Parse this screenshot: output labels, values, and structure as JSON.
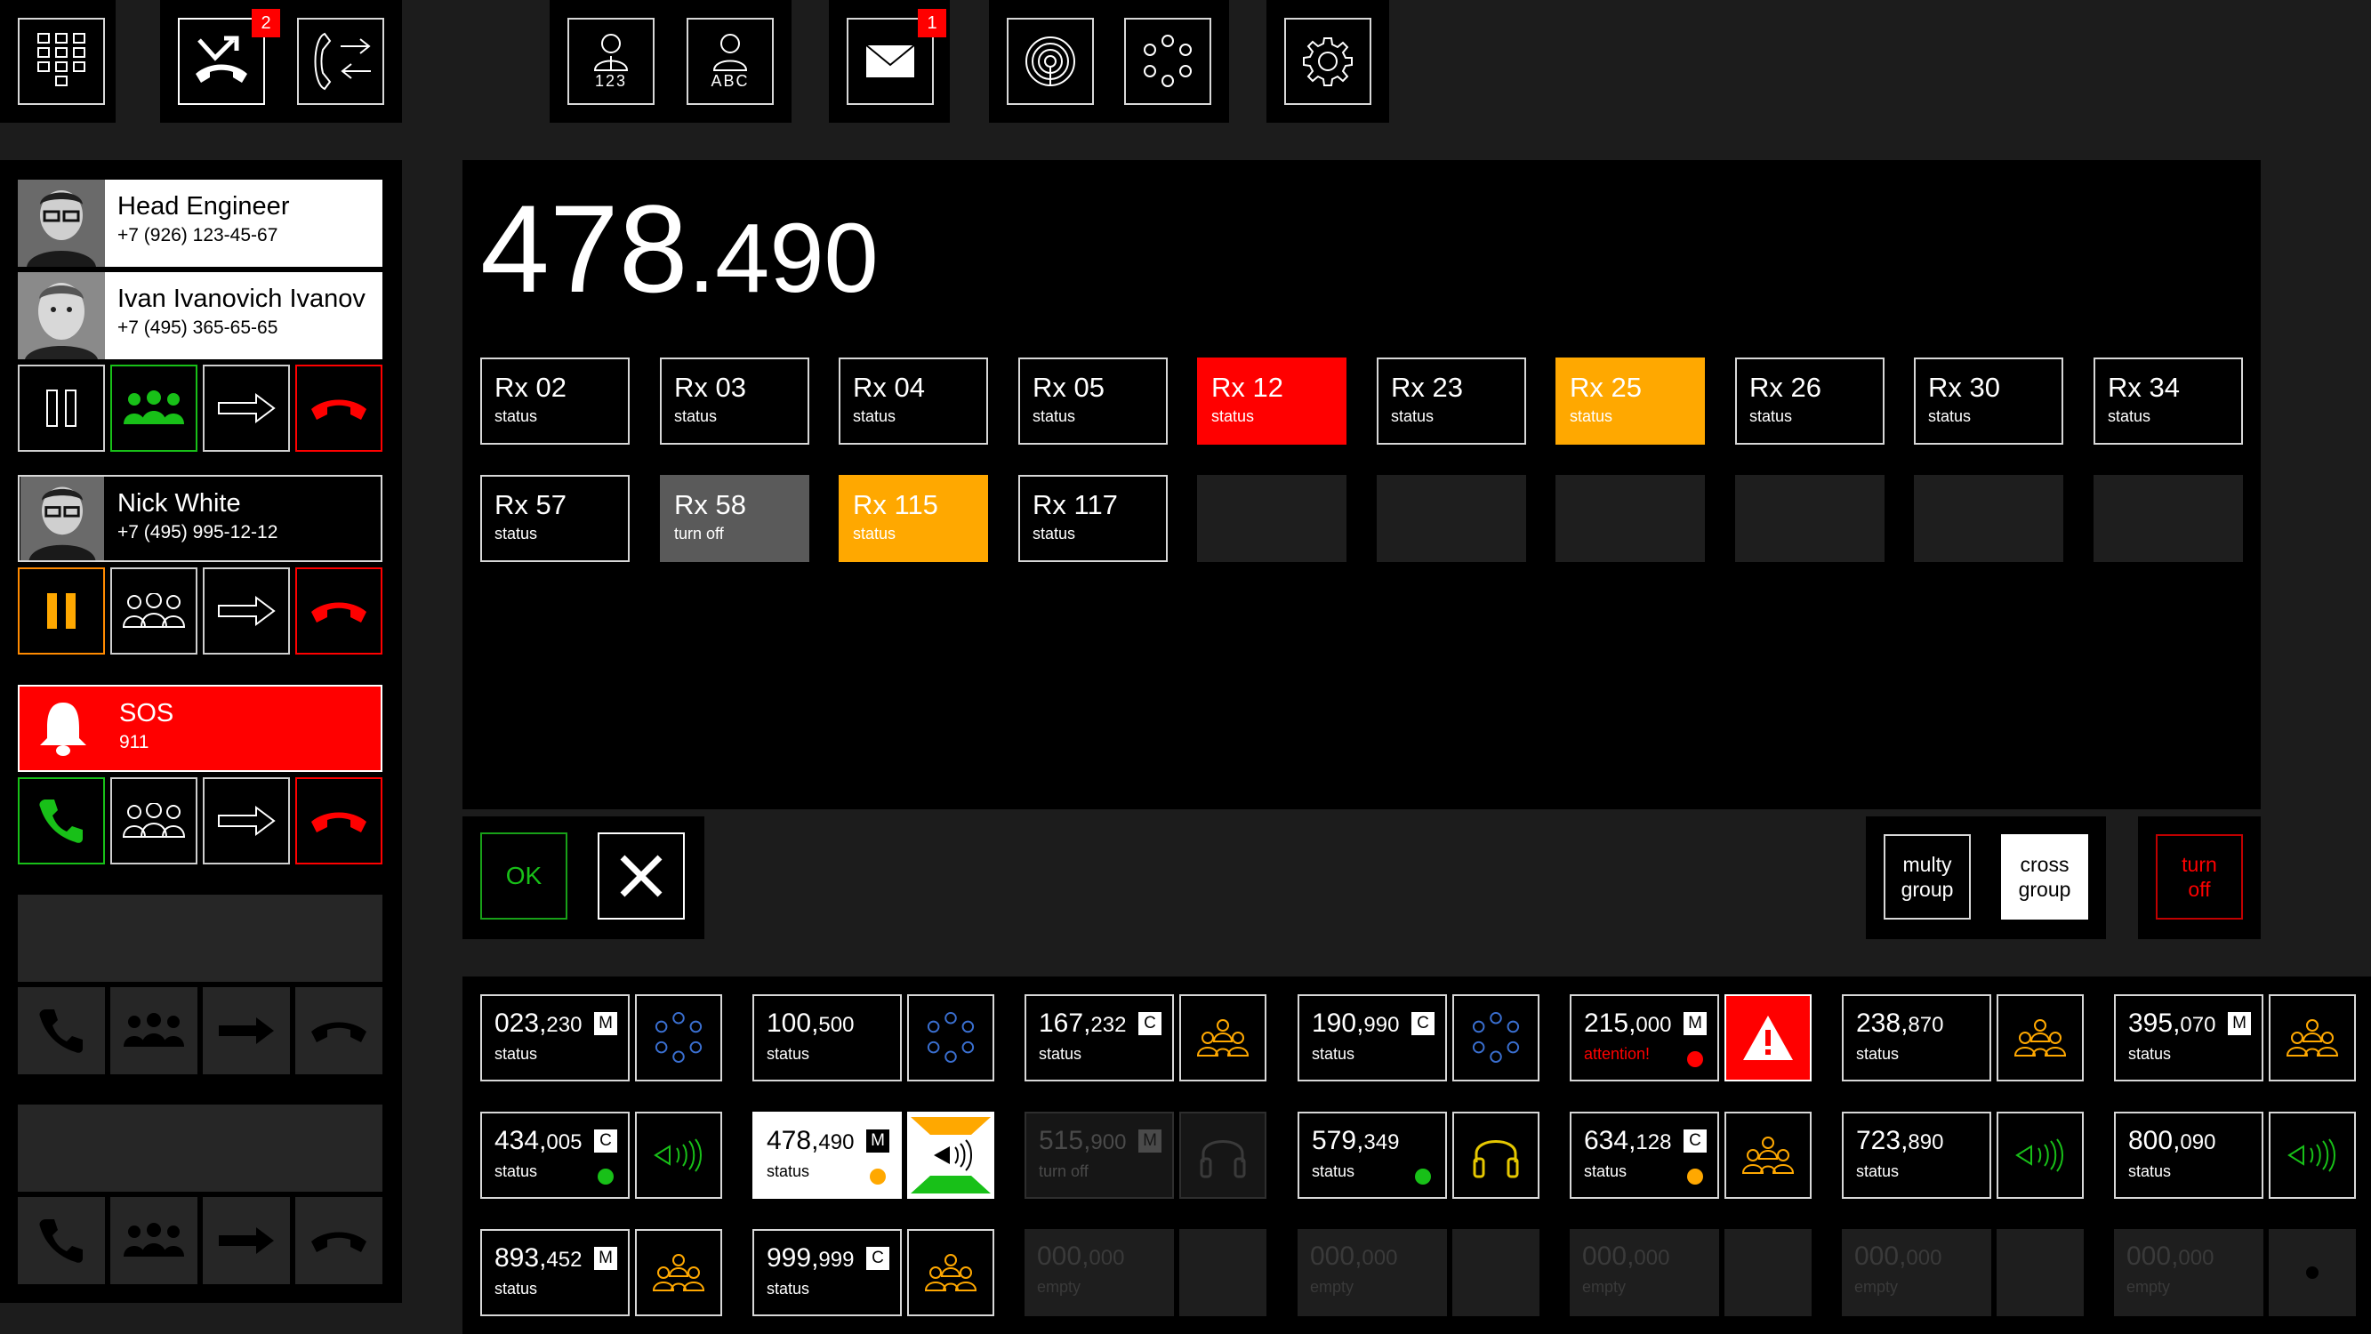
{
  "toolbar": {
    "missed_calls_badge": "2",
    "messages_badge": "1",
    "contacts_by_number_label": "123",
    "contacts_by_name_label": "ABC"
  },
  "calls": [
    {
      "name": "Head Engineer",
      "number": "+7 (926) 123-45-67"
    },
    {
      "name": "Ivan Ivanovich Ivanov",
      "number": "+7 (495) 365-65-65"
    },
    {
      "name": "Nick White",
      "number": "+7 (495) 995-12-12"
    },
    {
      "name": "SOS",
      "number": "911"
    }
  ],
  "frequency": {
    "main": "478",
    "sub": "490"
  },
  "receivers": [
    {
      "label": "Rx 02",
      "status": "status",
      "state": "normal"
    },
    {
      "label": "Rx 03",
      "status": "status",
      "state": "normal"
    },
    {
      "label": "Rx 04",
      "status": "status",
      "state": "normal"
    },
    {
      "label": "Rx 05",
      "status": "status",
      "state": "normal"
    },
    {
      "label": "Rx 12",
      "status": "status",
      "state": "red"
    },
    {
      "label": "Rx 23",
      "status": "status",
      "state": "normal"
    },
    {
      "label": "Rx 25",
      "status": "status",
      "state": "orange"
    },
    {
      "label": "Rx 26",
      "status": "status",
      "state": "normal"
    },
    {
      "label": "Rx 30",
      "status": "status",
      "state": "normal"
    },
    {
      "label": "Rx 34",
      "status": "status",
      "state": "normal"
    },
    {
      "label": "Rx 57",
      "status": "status",
      "state": "normal"
    },
    {
      "label": "Rx 58",
      "status": "turn off",
      "state": "grey"
    },
    {
      "label": "Rx 115",
      "status": "status",
      "state": "orange"
    },
    {
      "label": "Rx 117",
      "status": "status",
      "state": "normal"
    }
  ],
  "actions": {
    "ok_label": "OK",
    "multy_group_label": "multy\ngroup",
    "cross_group_label": "cross\ngroup",
    "turn_off_label": "turn\noff"
  },
  "channels": [
    {
      "main": "023",
      "sub": "230",
      "tag": "M",
      "status": "status"
    },
    {
      "main": "100",
      "sub": "500",
      "tag": "",
      "status": "status"
    },
    {
      "main": "167",
      "sub": "232",
      "tag": "C",
      "status": "status"
    },
    {
      "main": "190",
      "sub": "990",
      "tag": "C",
      "status": "status"
    },
    {
      "main": "215",
      "sub": "000",
      "tag": "M",
      "status": "attention!"
    },
    {
      "main": "238",
      "sub": "870",
      "tag": "",
      "status": "status"
    },
    {
      "main": "395",
      "sub": "070",
      "tag": "M",
      "status": "status"
    },
    {
      "main": "434",
      "sub": "005",
      "tag": "C",
      "status": "status"
    },
    {
      "main": "478",
      "sub": "490",
      "tag": "M",
      "status": "status"
    },
    {
      "main": "515",
      "sub": "900",
      "tag": "M",
      "status": "turn off"
    },
    {
      "main": "579",
      "sub": "349",
      "tag": "",
      "status": "status"
    },
    {
      "main": "634",
      "sub": "128",
      "tag": "C",
      "status": "status"
    },
    {
      "main": "723",
      "sub": "890",
      "tag": "",
      "status": "status"
    },
    {
      "main": "800",
      "sub": "090",
      "tag": "",
      "status": "status"
    },
    {
      "main": "893",
      "sub": "452",
      "tag": "M",
      "status": "status"
    },
    {
      "main": "999",
      "sub": "999",
      "tag": "C",
      "status": "status"
    },
    {
      "main": "000",
      "sub": "000",
      "tag": "",
      "status": "empty"
    },
    {
      "main": "000",
      "sub": "000",
      "tag": "",
      "status": "empty"
    },
    {
      "main": "000",
      "sub": "000",
      "tag": "",
      "status": "empty"
    },
    {
      "main": "000",
      "sub": "000",
      "tag": "",
      "status": "empty"
    },
    {
      "main": "000",
      "sub": "000",
      "tag": "",
      "status": "empty"
    }
  ],
  "colors": {
    "red": "#ff0000",
    "orange": "#ffa800",
    "green": "#18c018",
    "blue": "#3a6fd0",
    "yellow": "#e6c800"
  }
}
